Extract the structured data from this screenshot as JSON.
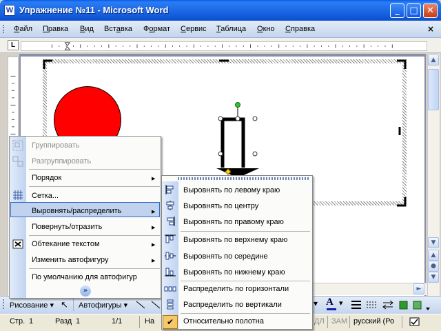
{
  "window": {
    "title": "Упражнение №11 - Microsoft Word",
    "app_icon": "W",
    "minimize": "_",
    "maximize": "□",
    "close": "✕"
  },
  "menubar": {
    "items": [
      "Файл",
      "Правка",
      "Вид",
      "Вставка",
      "Формат",
      "Сервис",
      "Таблица",
      "Окно",
      "Справка"
    ],
    "underline": [
      "Ф",
      "П",
      "В",
      "а",
      "о",
      "С",
      "Т",
      "О",
      "С"
    ],
    "close": "×"
  },
  "ruler": {
    "tab_label": "L"
  },
  "context_menu": {
    "items": [
      {
        "label": "Группировать",
        "disabled": true
      },
      {
        "label": "Разгруппировать",
        "disabled": true
      },
      {
        "label": "Порядок",
        "submenu": true
      },
      {
        "label": "Сетка..."
      },
      {
        "label": "Выровнять/распределить",
        "submenu": true,
        "highlighted": true
      },
      {
        "label": "Повернуть/отразить",
        "submenu": true
      },
      {
        "label": "Обтекание текстом",
        "submenu": true
      },
      {
        "label": "Изменить автофигуру",
        "submenu": true
      },
      {
        "label": "По умолчанию для автофигур"
      }
    ],
    "expand": "»"
  },
  "align_submenu": {
    "items": [
      "Выровнять по левому краю",
      "Выровнять по центру",
      "Выровнять по правому краю",
      "Выровнять по верхнему краю",
      "Выровнять по середине",
      "Выровнять по нижнему краю",
      "Распределить по горизонтали",
      "Распределить по вертикали",
      "Относительно полотна"
    ],
    "checked": "Относительно полотна"
  },
  "drawing_toolbar": {
    "drawing": "Рисование",
    "autoshapes": "Автофигуры"
  },
  "statusbar": {
    "page": "Стр.",
    "page_num": "1",
    "section": "Разд",
    "section_num": "1",
    "pages": "1/1",
    "at": "На",
    "indicator_ext": "ДЛ",
    "indicator_ovr": "ЗАМ",
    "language": "русский (Ро"
  },
  "colors": {
    "title_blue": "#0a5ce8",
    "circle": "#ff0000",
    "menu_highlight": "#c1d2ee"
  }
}
